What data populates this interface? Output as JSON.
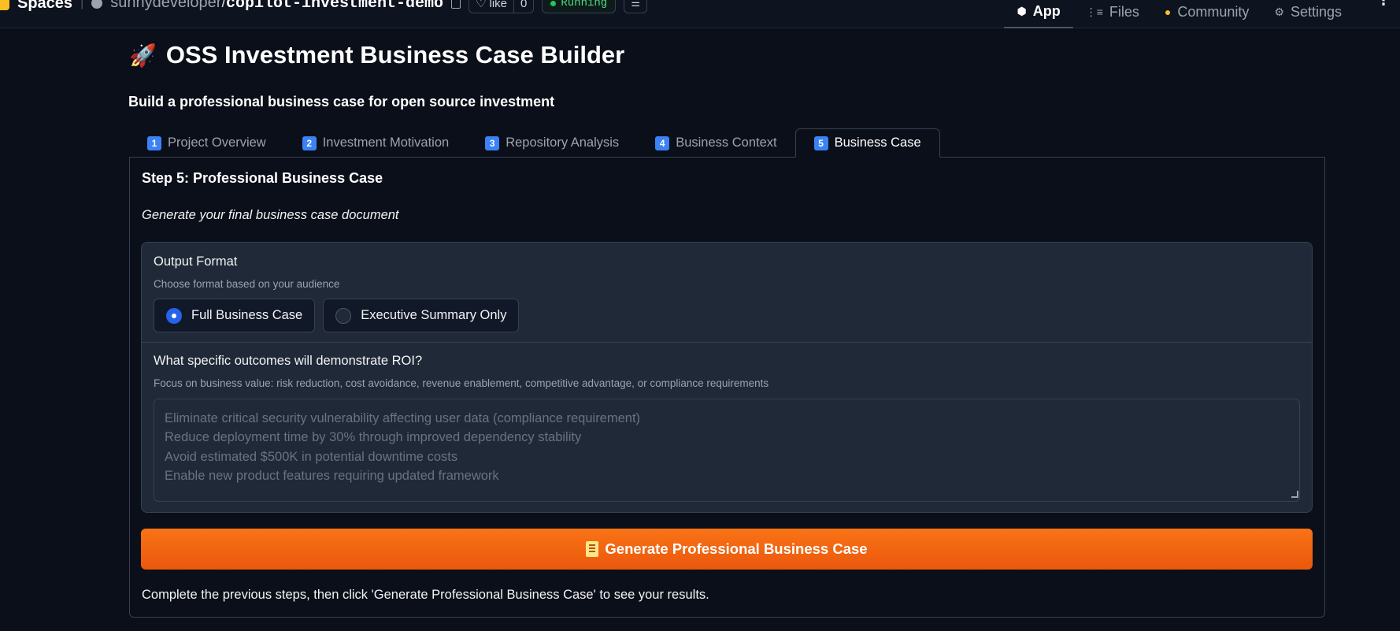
{
  "topbar": {
    "spaces_label": "Spaces",
    "owner": "sunnydeveloper",
    "separator": "/",
    "repo": "copilot-investment-demo",
    "like_label": "like",
    "like_count": "0",
    "status": "Running",
    "nav": [
      {
        "label": "App",
        "icon": "cube-icon",
        "active": true
      },
      {
        "label": "Files",
        "icon": "files-icon",
        "active": false
      },
      {
        "label": "Community",
        "icon": "community-icon",
        "active": false
      },
      {
        "label": "Settings",
        "icon": "gear-icon",
        "active": false
      }
    ]
  },
  "main": {
    "title": "OSS Investment Business Case Builder",
    "subtitle": "Build a professional business case for open source investment",
    "tabs": [
      {
        "num": "1",
        "label": "Project Overview"
      },
      {
        "num": "2",
        "label": "Investment Motivation"
      },
      {
        "num": "3",
        "label": "Repository Analysis"
      },
      {
        "num": "4",
        "label": "Business Context"
      },
      {
        "num": "5",
        "label": "Business Case"
      }
    ],
    "active_tab": 4,
    "step_title": "Step 5: Professional Business Case",
    "step_desc": "Generate your final business case document",
    "output_format": {
      "label": "Output Format",
      "info": "Choose format based on your audience",
      "options": [
        "Full Business Case",
        "Executive Summary Only"
      ],
      "selected": "Full Business Case"
    },
    "roi": {
      "label": "What specific outcomes will demonstrate ROI?",
      "info": "Focus on business value: risk reduction, cost avoidance, revenue enablement, competitive advantage, or compliance requirements",
      "placeholder": "Eliminate critical security vulnerability affecting user data (compliance requirement)\nReduce deployment time by 30% through improved dependency stability\nAvoid estimated $500K in potential downtime costs\nEnable new product features requiring updated framework"
    },
    "generate_button": "Generate Professional Business Case",
    "result_text": "Complete the previous steps, then click 'Generate Professional Business Case' to see your results."
  },
  "colors": {
    "background": "#0b0f19",
    "accent": "#f97316",
    "radio_selected": "#2563eb",
    "status_green": "#22c55e"
  }
}
